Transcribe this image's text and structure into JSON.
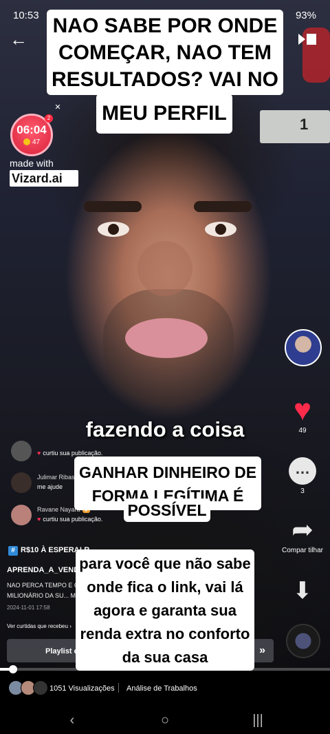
{
  "status_bar": {
    "time": "10:53",
    "battery": "93%"
  },
  "captions": {
    "top_line1": "NAO SABE POR ONDE COMEÇAR, NAO TEM RESULTADOS? VAI NO",
    "top_line2": "MEU PERFIL",
    "subtitle": "fazendo a coisa",
    "mid_line1": "GANHAR DINHEIRO DE FORMA LEGÍTIMA É",
    "mid_line2": "POSSÍVEL",
    "bottom": "para você que não sabe onde fica o link, vai lá agora e garanta sua renda extra no conforto da sua casa"
  },
  "timer": {
    "time": "06:04",
    "count": "47",
    "badge": "2"
  },
  "watermark": {
    "made_with": "made with",
    "brand": "Vizard.ai"
  },
  "comments": [
    {
      "name": "",
      "text": "curtiu sua publicação."
    },
    {
      "name": "Julimar Ribas",
      "text": "me ajude"
    },
    {
      "name": "Ravane Nayara",
      "text": "curtiu sua publicação."
    }
  ],
  "post": {
    "tag": "R$10 À ESPERA! R",
    "author": "APRENDA_A_VENDE",
    "description": "NAO PERCA TEMPO E C MILIONÁRIO DA SU... M",
    "date": "2024-11-01 17:58",
    "reposts": "Ver curtidas que recebeu",
    "playlist": "Playlist co"
  },
  "rail": {
    "likes": "49",
    "comments": "3",
    "share_label": "Compar tilhar"
  },
  "progress": 0.04,
  "stats": {
    "views": "1051 Visualizações",
    "analysis": "Análise de Trabalhos"
  },
  "colors": {
    "like": "#ff2b4b",
    "timer": "#d8213a",
    "caption_bg": "#ffffff"
  },
  "icons": [
    "back-arrow-icon",
    "cast-icon",
    "heart-icon",
    "comment-icon",
    "share-icon",
    "download-icon",
    "hashtag-icon",
    "fast-forward-icon",
    "nav-back-icon",
    "nav-home-icon",
    "nav-recent-icon"
  ]
}
